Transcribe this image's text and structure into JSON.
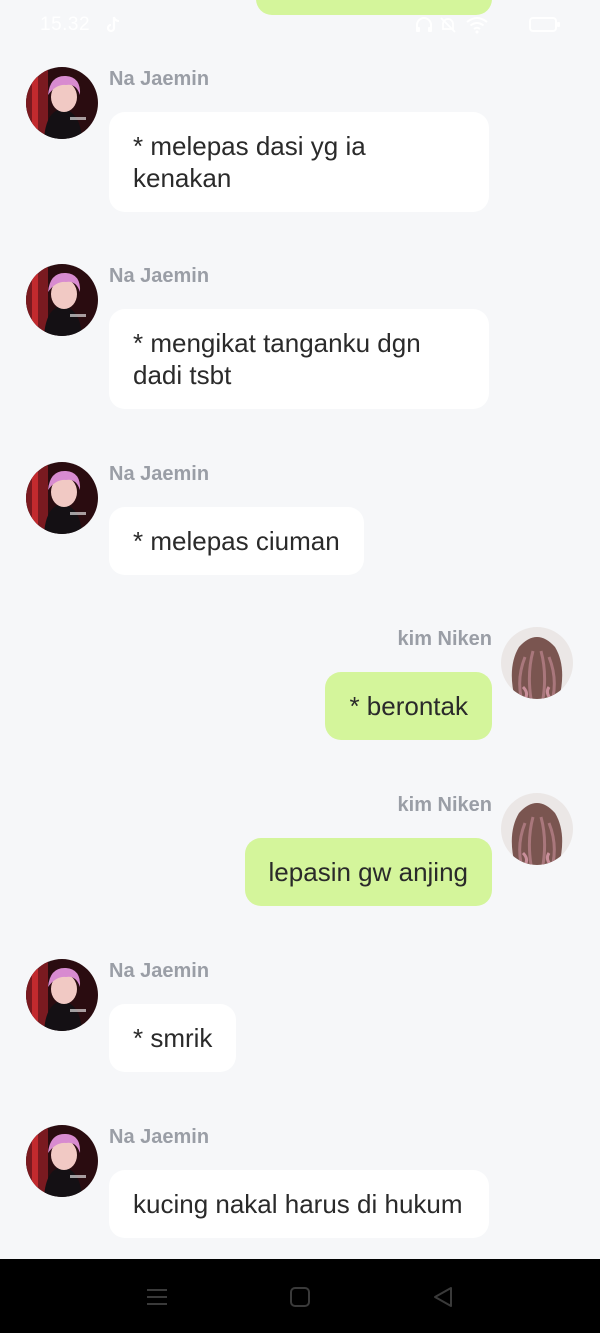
{
  "status_bar": {
    "time": "15.32",
    "icons": [
      "tiktok-icon",
      "headphones-icon",
      "mute-icon",
      "wifi-icon",
      "battery-icon"
    ]
  },
  "chat": {
    "messages": [
      {
        "side": "left",
        "sender": "Na Jaemin",
        "text": "* melepas dasi yg ia kenakan"
      },
      {
        "side": "left",
        "sender": "Na Jaemin",
        "text": "* mengikat tanganku dgn dadi tsbt"
      },
      {
        "side": "left",
        "sender": "Na Jaemin",
        "text": "* melepas ciuman"
      },
      {
        "side": "right",
        "sender": "kim Niken",
        "text": "* berontak"
      },
      {
        "side": "right",
        "sender": "kim Niken",
        "text": "lepasin gw anjing"
      },
      {
        "side": "left",
        "sender": "Na Jaemin",
        "text": "* smrik"
      },
      {
        "side": "left",
        "sender": "Na Jaemin",
        "text": "kucing nakal harus di hukum"
      }
    ]
  },
  "nav_bar": {
    "buttons": [
      "menu-icon",
      "home-icon",
      "back-icon"
    ]
  },
  "colors": {
    "background": "#f6f7f9",
    "bubble_left": "#ffffff",
    "bubble_right": "#d4f59b",
    "sender_name": "#9a9ea6",
    "nav_bar": "#000000"
  }
}
